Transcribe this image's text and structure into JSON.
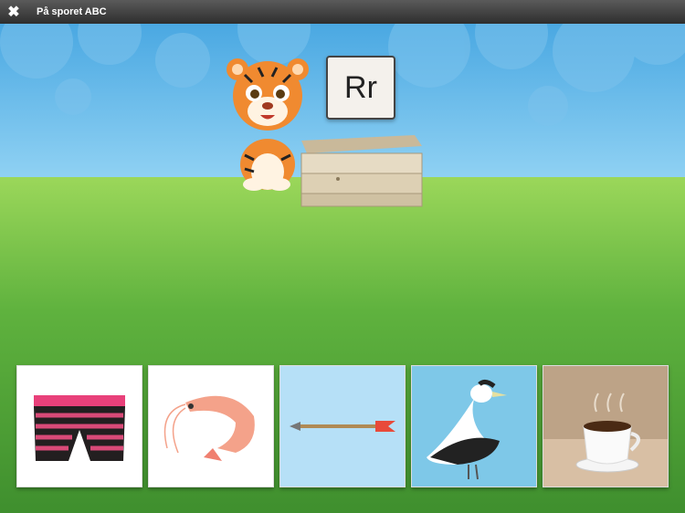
{
  "header": {
    "title": "På sporet ABC",
    "close_icon": "close-icon"
  },
  "game": {
    "letter": "Rr",
    "character": "tiger",
    "options": [
      {
        "name": "underpants",
        "bg": "#ffffff"
      },
      {
        "name": "shrimp",
        "bg": "#ffffff"
      },
      {
        "name": "arrow",
        "bg": "#b6e0f7"
      },
      {
        "name": "eider-duck",
        "bg": "#7ec8e8"
      },
      {
        "name": "coffee-cup",
        "bg": "#d8bfa4"
      }
    ]
  }
}
